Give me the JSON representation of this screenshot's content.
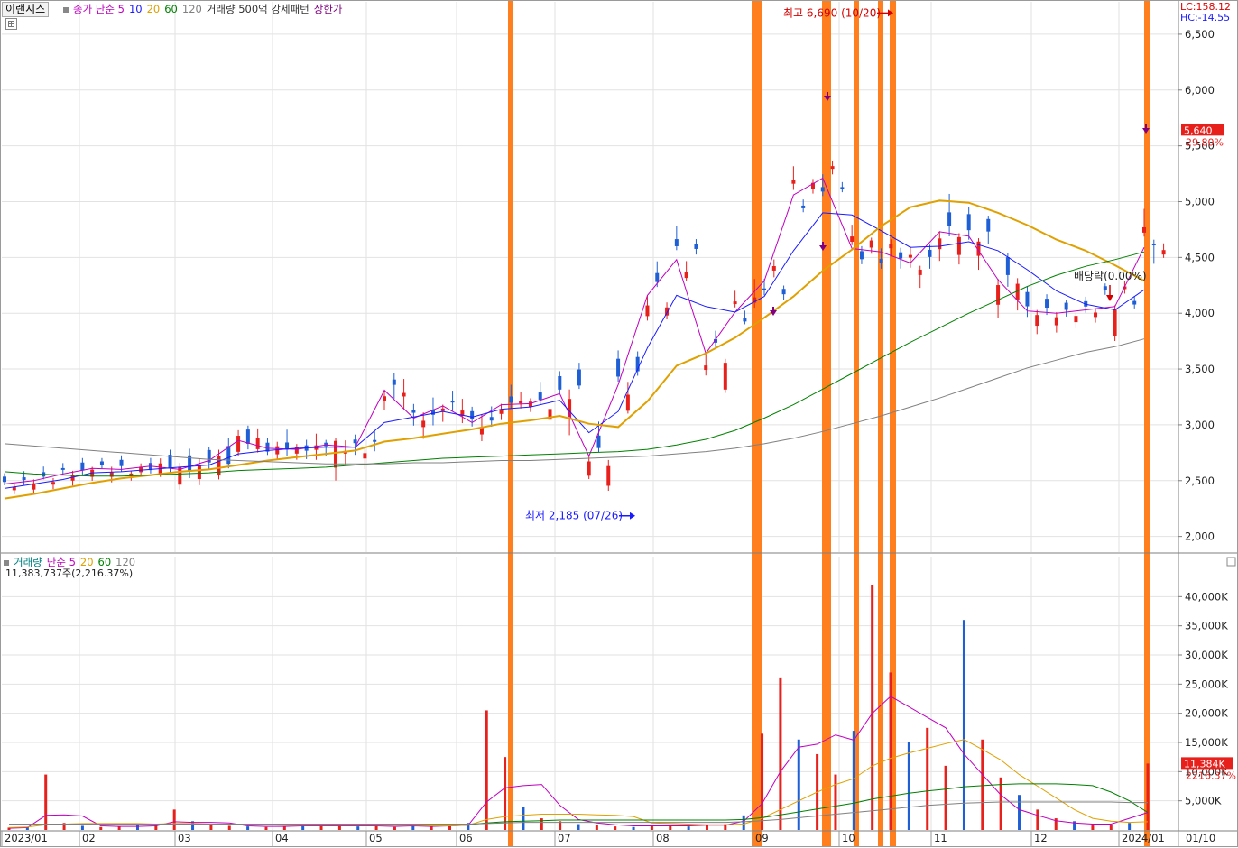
{
  "window": {
    "stock_name": "이랜시스",
    "main_legend": {
      "items": [
        {
          "label": "종가 단순 5",
          "color": "#c000c0"
        },
        {
          "label": "10",
          "color": "#1a1aff"
        },
        {
          "label": "20",
          "color": "#e0a000"
        },
        {
          "label": "60",
          "color": "#008000"
        },
        {
          "label": "120",
          "color": "#808080"
        },
        {
          "label": "거래량 500억 강세패턴",
          "color": "#333333"
        },
        {
          "label": "상한가",
          "color": "#800080"
        }
      ]
    },
    "volume_legend": {
      "items": [
        {
          "label": "거래량",
          "color": "#008080"
        },
        {
          "label": "단순 5",
          "color": "#c000c0"
        },
        {
          "label": "20",
          "color": "#e0a000"
        },
        {
          "label": "60",
          "color": "#008000"
        },
        {
          "label": "120",
          "color": "#808080"
        }
      ],
      "value_text": "11,383,737주(2,216.37%)"
    },
    "scale_info": {
      "lc": "LC:158.12",
      "hc": "HC:-14.55"
    }
  },
  "chart_data": [
    {
      "type": "candlestick",
      "title": "이랜시스",
      "ylim": [
        1900,
        6750
      ],
      "y_ticks": [
        2000,
        2500,
        3000,
        3500,
        4000,
        4500,
        5000,
        5500,
        6000,
        6500
      ],
      "y_tick_labels": [
        "2,000",
        "2,500",
        "3,000",
        "3,500",
        "4,000",
        "4,500",
        "5,000",
        "5,500",
        "6,000",
        "6,500"
      ],
      "x_tick_labels": [
        "2023/01",
        "02",
        "03",
        "04",
        "05",
        "06",
        "07",
        "08",
        "09",
        "10",
        "11",
        "12",
        "2024/01",
        "01/10"
      ],
      "last_price": {
        "label": "5,640",
        "value": 5640,
        "change": "29.80%"
      },
      "annotations": [
        {
          "text": "최고 6,690 (10/20)",
          "value": 6690
        },
        {
          "text": "최저 2,185 (07/26)",
          "value": 2185
        },
        {
          "text": "배당락(0.00%)"
        }
      ],
      "grid": true,
      "series": [
        {
          "name": "종가 단순 5",
          "values": [
            2470,
            2500,
            2560,
            2610,
            2600,
            2630,
            2600,
            2680,
            2860,
            2790,
            2780,
            2820,
            2800,
            3310,
            3060,
            3170,
            3020,
            3180,
            3190,
            3280,
            2720,
            3360,
            4160,
            4480,
            3640,
            4010,
            4290,
            5060,
            5210,
            4580,
            4550,
            4450,
            4730,
            4690,
            4300,
            4020,
            4000,
            4030,
            4060,
            4590
          ]
        },
        {
          "name": "10",
          "values": [
            2430,
            2470,
            2510,
            2570,
            2580,
            2600,
            2620,
            2640,
            2740,
            2770,
            2790,
            2800,
            2800,
            3020,
            3070,
            3120,
            3070,
            3140,
            3160,
            3220,
            2930,
            3120,
            3690,
            4160,
            4060,
            4010,
            4150,
            4560,
            4900,
            4880,
            4740,
            4590,
            4600,
            4640,
            4560,
            4390,
            4200,
            4080,
            4030,
            4210
          ]
        },
        {
          "name": "20",
          "values": [
            2340,
            2380,
            2430,
            2480,
            2520,
            2550,
            2580,
            2600,
            2640,
            2680,
            2710,
            2740,
            2770,
            2850,
            2880,
            2920,
            2960,
            3010,
            3040,
            3080,
            3010,
            2980,
            3210,
            3530,
            3640,
            3780,
            3960,
            4150,
            4380,
            4570,
            4780,
            4950,
            5010,
            4990,
            4900,
            4790,
            4660,
            4560,
            4430,
            4290
          ]
        },
        {
          "name": "60",
          "values": [
            2580,
            2560,
            2550,
            2540,
            2540,
            2550,
            2560,
            2570,
            2590,
            2600,
            2610,
            2620,
            2640,
            2660,
            2680,
            2700,
            2710,
            2720,
            2730,
            2740,
            2750,
            2760,
            2780,
            2820,
            2870,
            2950,
            3060,
            3180,
            3320,
            3460,
            3600,
            3740,
            3870,
            4000,
            4120,
            4240,
            4340,
            4420,
            4480,
            4550
          ]
        },
        {
          "name": "120",
          "values": [
            2830,
            2810,
            2790,
            2770,
            2750,
            2730,
            2710,
            2690,
            2680,
            2670,
            2660,
            2650,
            2650,
            2650,
            2660,
            2660,
            2670,
            2680,
            2680,
            2690,
            2700,
            2710,
            2720,
            2740,
            2760,
            2790,
            2830,
            2880,
            2940,
            3010,
            3080,
            3160,
            3240,
            3330,
            3420,
            3510,
            3580,
            3650,
            3700,
            3770
          ]
        }
      ]
    },
    {
      "type": "bar",
      "title": "거래량",
      "ylim": [
        0,
        45000
      ],
      "y_ticks": [
        5000,
        10000,
        15000,
        20000,
        25000,
        30000,
        35000,
        40000
      ],
      "y_tick_labels": [
        "5,000K",
        "10,000K",
        "15,000K",
        "20,000K",
        "25,000K",
        "30,000K",
        "35,000K",
        "40,000K"
      ],
      "last_volume": {
        "label": "11,384K",
        "value": 11384,
        "ratio": "2216.37%"
      },
      "grid": true,
      "series": [
        {
          "name": "거래량",
          "values": [
            400,
            500,
            9500,
            1200,
            700,
            500,
            600,
            800,
            900,
            3500,
            1500,
            900,
            700,
            600,
            500,
            600,
            800,
            700,
            900,
            600,
            800,
            500,
            700,
            600,
            900,
            1200,
            20500,
            12500,
            4000,
            2000,
            1500,
            1000,
            800,
            600,
            500,
            700,
            900,
            600,
            800,
            1000,
            2500,
            16500,
            26000,
            15500,
            13000,
            9500,
            17000,
            42000,
            27000,
            15000,
            17500,
            11000,
            36000,
            15500,
            9000,
            6000,
            3500,
            2000,
            1500,
            1000,
            800,
            1200,
            11384
          ]
        },
        {
          "name": "단순 5",
          "values": [
            300,
            400,
            2500,
            2600,
            2400,
            700,
            600,
            600,
            700,
            1400,
            1300,
            1300,
            1200,
            700,
            600,
            600,
            700,
            700,
            700,
            700,
            700,
            600,
            700,
            600,
            700,
            800,
            4800,
            7200,
            7600,
            7800,
            4200,
            1800,
            1200,
            900,
            700,
            700,
            700,
            700,
            800,
            800,
            1500,
            4500,
            10000,
            14200,
            14700,
            16300,
            15400,
            20000,
            22900,
            21100,
            19300,
            17500,
            13000,
            9500,
            6000,
            3500,
            2500,
            1600,
            1200,
            1000,
            1000,
            2000,
            3000
          ]
        },
        {
          "name": "20",
          "values": [
            400,
            500,
            900,
            1000,
            1100,
            1100,
            1100,
            1100,
            1000,
            1100,
            1100,
            1000,
            900,
            900,
            900,
            800,
            800,
            800,
            800,
            800,
            800,
            800,
            800,
            700,
            700,
            800,
            1800,
            2300,
            2500,
            2700,
            2700,
            2700,
            2600,
            2500,
            2300,
            1200,
            1100,
            1000,
            900,
            900,
            1000,
            2000,
            3500,
            5000,
            6500,
            7800,
            8800,
            11000,
            12300,
            13200,
            14000,
            14800,
            15500,
            13800,
            12000,
            9500,
            7500,
            5500,
            3500,
            2000,
            1500,
            1300,
            1400
          ]
        },
        {
          "name": "60",
          "values": [
            900,
            900,
            900,
            1000,
            1000,
            1000,
            1000,
            1000,
            1000,
            1000,
            1000,
            1000,
            1000,
            1000,
            1000,
            1000,
            900,
            900,
            900,
            900,
            900,
            900,
            900,
            900,
            900,
            900,
            1200,
            1400,
            1500,
            1600,
            1700,
            1700,
            1700,
            1700,
            1700,
            1700,
            1700,
            1700,
            1700,
            1700,
            1800,
            2100,
            2600,
            3100,
            3600,
            4100,
            4600,
            5300,
            5800,
            6300,
            6700,
            7000,
            7400,
            7600,
            7800,
            7900,
            7900,
            7900,
            7800,
            7600,
            6500,
            5000,
            3000
          ]
        },
        {
          "name": "120",
          "values": [
            1000,
            1000,
            1000,
            1000,
            1000,
            1000,
            1000,
            1000,
            1000,
            1000,
            1000,
            1000,
            1000,
            1000,
            1000,
            1000,
            1000,
            1000,
            1000,
            1000,
            1000,
            1000,
            1000,
            1000,
            1000,
            1000,
            1100,
            1200,
            1300,
            1300,
            1300,
            1300,
            1300,
            1300,
            1300,
            1300,
            1300,
            1300,
            1300,
            1300,
            1400,
            1600,
            1800,
            2100,
            2400,
            2700,
            3000,
            3300,
            3600,
            3900,
            4200,
            4400,
            4600,
            4700,
            4800,
            4800,
            4800,
            4800,
            4800,
            4800,
            4800,
            4700,
            4700
          ]
        }
      ]
    }
  ]
}
